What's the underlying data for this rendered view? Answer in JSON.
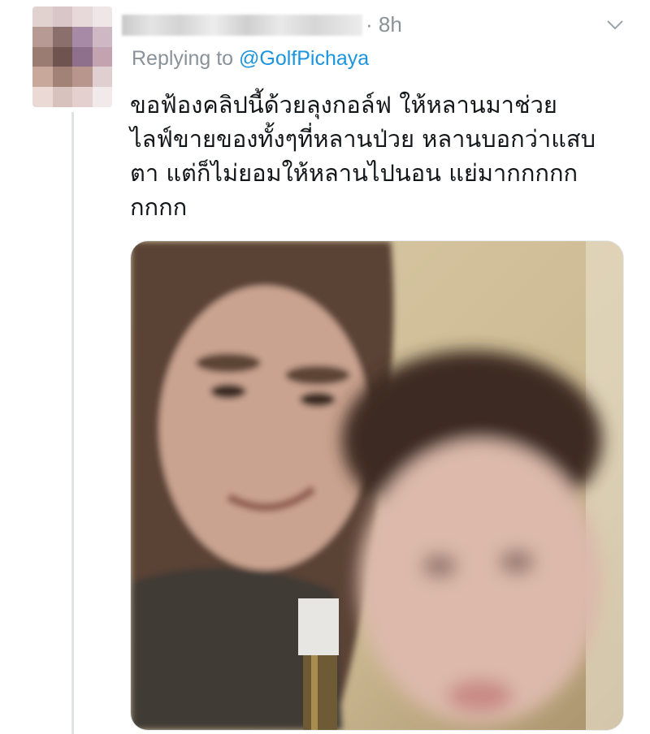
{
  "tweet": {
    "time": "· 8h",
    "replying_prefix": "Replying to",
    "replying_handle": "@GolfPichaya",
    "text_lines": [
      "ขอฟ้องคลิปนี้ด้วยลุงกอล์ฟ  ให้หลานมาช่วย",
      "ไลฟ์ขายของทั้งๆที่หลานป่วย  หลานบอกว่าแสบ",
      "ตา แต่ก็ไม่ยอมให้หลานไปนอน  แย่มากกกกก",
      "กกกก"
    ]
  },
  "icons": {
    "avatar": "avatar-blurred",
    "menu": "chevron-down-icon"
  },
  "colors": {
    "link": "#1b95e0",
    "muted": "#8a9299",
    "text": "#14171a"
  }
}
